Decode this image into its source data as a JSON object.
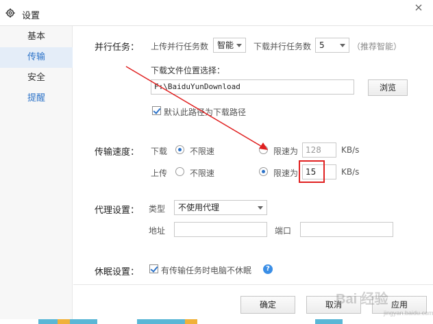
{
  "window": {
    "title": "设置",
    "icon": "gear-icon",
    "close_icon": "close-icon"
  },
  "sidebar": {
    "items": [
      {
        "label": "基本"
      },
      {
        "label": "传输"
      },
      {
        "label": "安全"
      },
      {
        "label": "提醒"
      }
    ]
  },
  "parallel": {
    "section": "并行任务：",
    "upload_label": "上传并行任务数",
    "upload_value": "智能",
    "download_label": "下载并行任务数",
    "download_value": "5",
    "hint": "（推荐智能）"
  },
  "location": {
    "label": "下载文件位置选择：",
    "path": "F:\\BaiduYunDownload",
    "browse": "浏览",
    "default_checkbox": "默认此路径为下载路径",
    "default_checked": true
  },
  "speed": {
    "section": "传输速度：",
    "download_label": "下载",
    "upload_label": "上传",
    "unlimited": "不限速",
    "limited": "限速为",
    "download_limit": "128",
    "upload_limit": "15",
    "unit": "KB/s",
    "download_mode": "unlimited",
    "upload_mode": "limited"
  },
  "proxy": {
    "section": "代理设置：",
    "type_label": "类型",
    "type_value": "不使用代理",
    "address_label": "地址",
    "port_label": "端口"
  },
  "sleep": {
    "section": "休眠设置：",
    "checkbox": "有传输任务时电脑不休眠",
    "checked": true,
    "help_icon": "help-icon",
    "help_glyph": "?"
  },
  "footer": {
    "ok": "确定",
    "cancel": "取消",
    "apply": "应用"
  },
  "watermark": {
    "text": "Bai 经验",
    "sub": "jingyan.baidu.com"
  },
  "colors": {
    "accent": "#2d73c8",
    "annotation": "#e02020"
  }
}
